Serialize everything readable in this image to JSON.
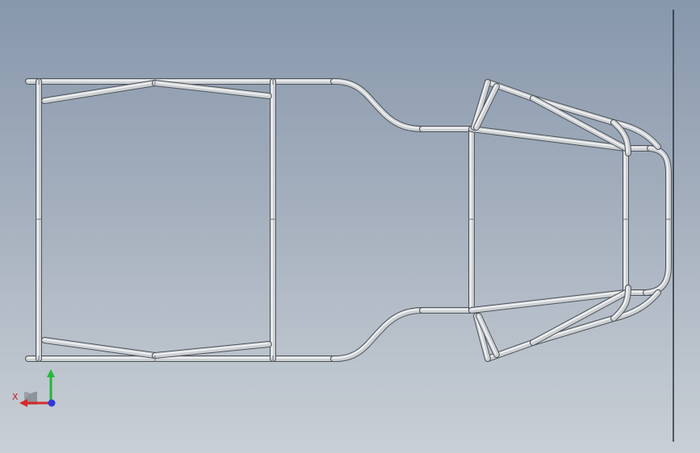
{
  "viewport": {
    "background_top": "#8797ac",
    "background_bottom": "#c9cfd6"
  },
  "model": {
    "part": "tube-frame-chassis",
    "tube_color": "#cdd0d3",
    "edge_color": "#4d535a"
  },
  "triad": {
    "x_label": "X",
    "x_color": "#d42a2a",
    "y_color": "#22b838",
    "z_color": "#2d3bd6"
  },
  "section_plane": {
    "color": "#1e2328"
  }
}
